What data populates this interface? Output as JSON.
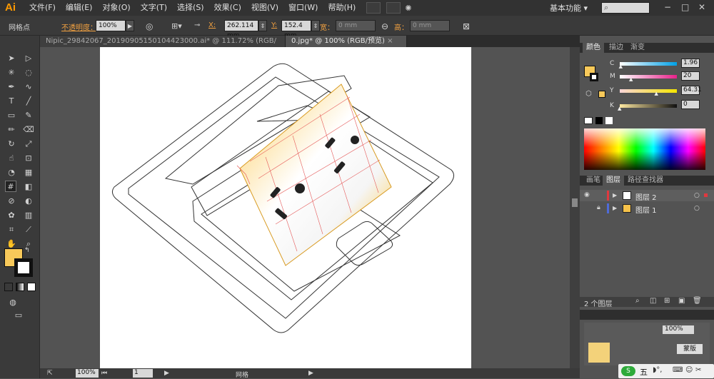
{
  "app": {
    "logo": "Ai",
    "workspace": "基本功能"
  },
  "menu": [
    "文件(F)",
    "编辑(E)",
    "对象(O)",
    "文字(T)",
    "选择(S)",
    "效果(C)",
    "视图(V)",
    "窗口(W)",
    "帮助(H)"
  ],
  "control": {
    "tool_label": "网格点",
    "opacity_label": "不透明度：",
    "opacity_value": "100%",
    "x_label": "X:",
    "x_value": "262.114 mm",
    "y_label": "Y:",
    "y_value": "152.4 mm",
    "w_label": "宽：",
    "w_value": "0 mm",
    "h_label": "高：",
    "h_value": "0 mm"
  },
  "tabs": [
    {
      "label": "Nipic_29842067_20190905150104423000.ai* @ 111.72% (RGB/预览)"
    },
    {
      "label": "0.jpg* @ 100% (RGB/预览)"
    }
  ],
  "status": {
    "zoom": "100%",
    "page": "1",
    "mode": "网格"
  },
  "color_panel": {
    "tabs": [
      "颜色",
      "描边",
      "渐变"
    ],
    "channels": [
      {
        "name": "C",
        "value": "1.96",
        "pos": 1.96
      },
      {
        "name": "M",
        "value": "20",
        "pos": 20
      },
      {
        "name": "Y",
        "value": "64.31",
        "pos": 64.31
      },
      {
        "name": "K",
        "value": "0",
        "pos": 0
      }
    ],
    "fill_color": "#f8c95a"
  },
  "layers_panel": {
    "tabs": [
      "画笔",
      "图层",
      "路径查找器"
    ],
    "layers": [
      {
        "name": "图层 2",
        "color": "#e0383f"
      },
      {
        "name": "图层 1",
        "color": "#4f6bd8"
      }
    ],
    "count": "2 个图层"
  },
  "bottom_panel": {
    "value": "100%",
    "button": "蒙版"
  },
  "taskbar": {
    "ime": "五"
  }
}
